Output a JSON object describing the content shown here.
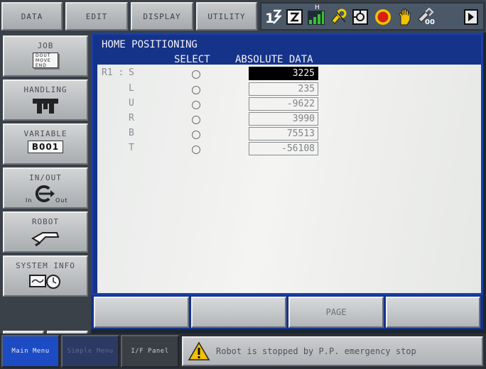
{
  "top_menu": [
    "DATA",
    "EDIT",
    "DISPLAY",
    "UTILITY"
  ],
  "status_icons": [
    "teach-mode-icon",
    "edit-cursor-icon",
    "speed-level-icon",
    "tool-icon",
    "coordinate-icon",
    "emergency-stop-icon",
    "hand-security-icon",
    "tool-number-icon",
    "scroll-right-icon"
  ],
  "status": {
    "speed_h": "H",
    "tool_no": "00"
  },
  "side_menu": [
    {
      "label": "JOB",
      "icon": "job-icon",
      "icon_text": [
        "DOUT",
        "MOVE",
        "END"
      ]
    },
    {
      "label": "HANDLING",
      "icon": "handling-icon"
    },
    {
      "label": "VARIABLE",
      "icon": "variable-icon",
      "icon_text": "B001"
    },
    {
      "label": "IN/OUT",
      "icon": "in-out-icon",
      "in_text": "In",
      "out_text": "Out"
    },
    {
      "label": "ROBOT",
      "icon": "robot-icon"
    },
    {
      "label": "SYSTEM INFO",
      "icon": "system-info-icon"
    }
  ],
  "main": {
    "title": "HOME POSITIONING",
    "col_select": "SELECT",
    "col_absolute": "ABSOLUTE DATA",
    "robot_label": "R1 :",
    "rows": [
      {
        "axis": "S",
        "value": "3225",
        "active": true
      },
      {
        "axis": "L",
        "value": "235",
        "active": false
      },
      {
        "axis": "U",
        "value": "-9622",
        "active": false
      },
      {
        "axis": "R",
        "value": "3990",
        "active": false
      },
      {
        "axis": "B",
        "value": "75513",
        "active": false
      },
      {
        "axis": "T",
        "value": "-56108",
        "active": false
      }
    ]
  },
  "function_keys": [
    "",
    "",
    "PAGE",
    ""
  ],
  "bottom": {
    "main_menu": "Main Menu",
    "simple_menu": "Simple Menu",
    "if_panel": "I/F Panel",
    "message": "Robot is stopped by P.P. emergency stop"
  },
  "colors": {
    "frame_blue": "#16338a",
    "main_menu_blue": "#1d4bc4",
    "alarm_yellow": "#f2c200"
  }
}
